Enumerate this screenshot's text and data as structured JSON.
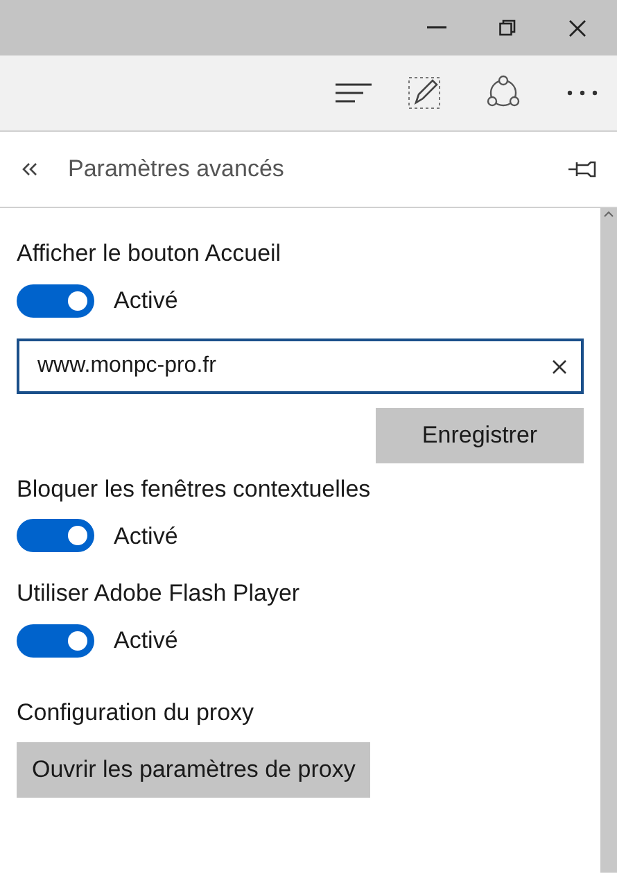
{
  "panel": {
    "title": "Paramètres avancés"
  },
  "settings": [
    {
      "kind": "toggle",
      "label": "Afficher le bouton Accueil",
      "on": true,
      "state_text": "Activé",
      "field": {
        "value": "www.monpc-pro.fr"
      },
      "button": "Enregistrer"
    },
    {
      "kind": "toggle",
      "label": "Bloquer les fenêtres contextuelles",
      "on": true,
      "state_text": "Activé"
    },
    {
      "kind": "toggle",
      "label": "Utiliser Adobe Flash Player",
      "on": true,
      "state_text": "Activé"
    },
    {
      "kind": "button",
      "label": "Configuration du proxy",
      "button": "Ouvrir les paramètres de proxy"
    }
  ]
}
